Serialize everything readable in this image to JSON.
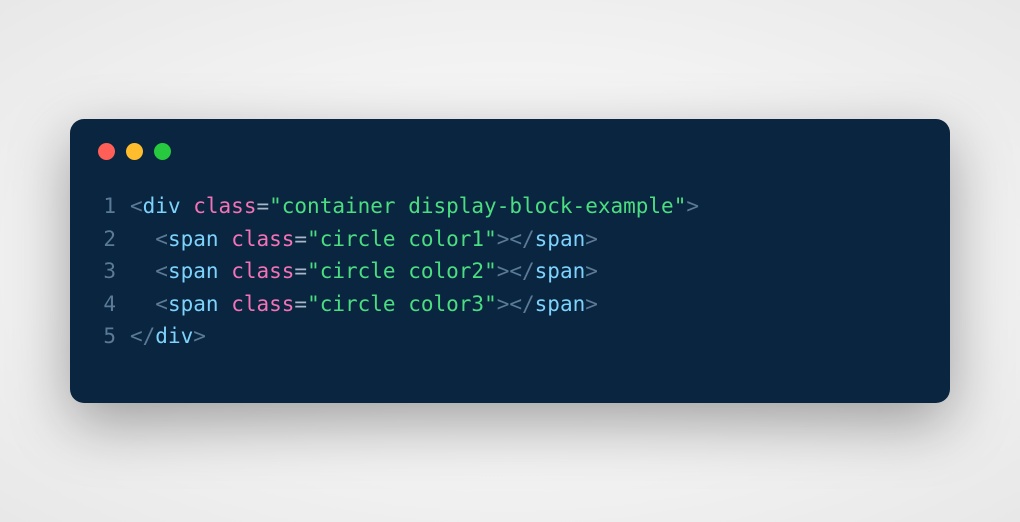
{
  "code": {
    "lines": [
      {
        "number": "1",
        "tokens": [
          {
            "class": "tok-bracket",
            "text": "<"
          },
          {
            "class": "tok-tag",
            "text": "div"
          },
          {
            "class": "",
            "text": " "
          },
          {
            "class": "tok-attr",
            "text": "class"
          },
          {
            "class": "tok-equals",
            "text": "="
          },
          {
            "class": "tok-string",
            "text": "\"container display-block-example\""
          },
          {
            "class": "tok-bracket",
            "text": ">"
          }
        ]
      },
      {
        "number": "2",
        "tokens": [
          {
            "class": "",
            "text": "  "
          },
          {
            "class": "tok-bracket",
            "text": "<"
          },
          {
            "class": "tok-tag",
            "text": "span"
          },
          {
            "class": "",
            "text": " "
          },
          {
            "class": "tok-attr",
            "text": "class"
          },
          {
            "class": "tok-equals",
            "text": "="
          },
          {
            "class": "tok-string",
            "text": "\"circle color1\""
          },
          {
            "class": "tok-bracket",
            "text": "></"
          },
          {
            "class": "tok-tag",
            "text": "span"
          },
          {
            "class": "tok-bracket",
            "text": ">"
          }
        ]
      },
      {
        "number": "3",
        "tokens": [
          {
            "class": "",
            "text": "  "
          },
          {
            "class": "tok-bracket",
            "text": "<"
          },
          {
            "class": "tok-tag",
            "text": "span"
          },
          {
            "class": "",
            "text": " "
          },
          {
            "class": "tok-attr",
            "text": "class"
          },
          {
            "class": "tok-equals",
            "text": "="
          },
          {
            "class": "tok-string",
            "text": "\"circle color2\""
          },
          {
            "class": "tok-bracket",
            "text": "></"
          },
          {
            "class": "tok-tag",
            "text": "span"
          },
          {
            "class": "tok-bracket",
            "text": ">"
          }
        ]
      },
      {
        "number": "4",
        "tokens": [
          {
            "class": "",
            "text": "  "
          },
          {
            "class": "tok-bracket",
            "text": "<"
          },
          {
            "class": "tok-tag",
            "text": "span"
          },
          {
            "class": "",
            "text": " "
          },
          {
            "class": "tok-attr",
            "text": "class"
          },
          {
            "class": "tok-equals",
            "text": "="
          },
          {
            "class": "tok-string",
            "text": "\"circle color3\""
          },
          {
            "class": "tok-bracket",
            "text": "></"
          },
          {
            "class": "tok-tag",
            "text": "span"
          },
          {
            "class": "tok-bracket",
            "text": ">"
          }
        ]
      },
      {
        "number": "5",
        "tokens": [
          {
            "class": "tok-bracket",
            "text": "</"
          },
          {
            "class": "tok-tag",
            "text": "div"
          },
          {
            "class": "tok-bracket",
            "text": ">"
          }
        ]
      }
    ]
  }
}
